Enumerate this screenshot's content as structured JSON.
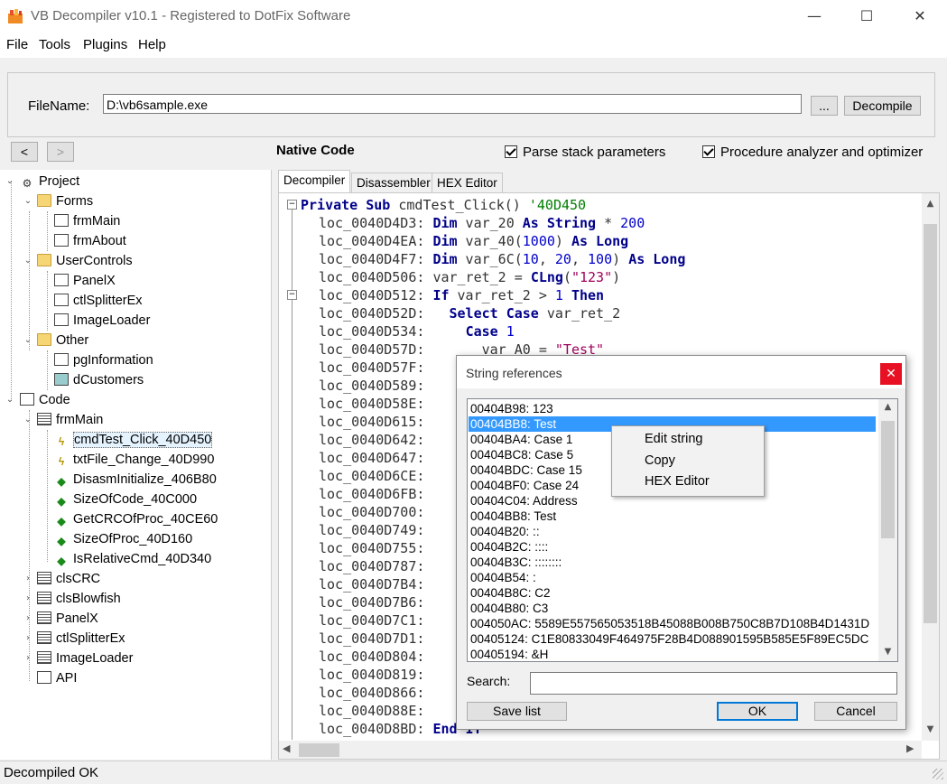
{
  "window": {
    "title": "VB Decompiler v10.1 - Registered to DotFix Software",
    "minimize": "—",
    "maximize": "☐",
    "close": "✕"
  },
  "menu": {
    "file": "File",
    "tools": "Tools",
    "plugins": "Plugins",
    "help": "Help"
  },
  "file_panel": {
    "label": "FileName:",
    "value": "D:\\vb6sample.exe",
    "browse": "...",
    "decompile": "Decompile"
  },
  "nav": {
    "back": "<",
    "forward": ">",
    "section_title": "Native Code",
    "parse_stack": "Parse stack parameters",
    "proc_analyzer": "Procedure analyzer and optimizer"
  },
  "tree": {
    "project": "Project",
    "forms": "Forms",
    "frmMain": "frmMain",
    "frmAbout": "frmAbout",
    "usercontrols": "UserControls",
    "PanelX": "PanelX",
    "ctlSplitterEx": "ctlSplitterEx",
    "ImageLoader": "ImageLoader",
    "other": "Other",
    "pgInformation": "pgInformation",
    "dCustomers": "dCustomers",
    "code": "Code",
    "code_frmMain": "frmMain",
    "procs": [
      "cmdTest_Click_40D450",
      "txtFile_Change_40D990",
      "DisasmInitialize_406B80",
      "SizeOfCode_40C000",
      "GetCRCOfProc_40CE60",
      "SizeOfProc_40D160",
      "IsRelativeCmd_40D340"
    ],
    "modules": [
      "clsCRC",
      "clsBlowfish",
      "PanelX",
      "ctlSplitterEx",
      "ImageLoader"
    ],
    "api": "API"
  },
  "tabs": {
    "decompiler": "Decompiler",
    "disassembler": "Disassembler",
    "hex": "HEX Editor"
  },
  "code": {
    "header": {
      "kw": "Private Sub",
      "name": " cmdTest_Click()",
      "comment": " '40D450"
    },
    "l1": {
      "loc": "loc_0040D4D3:",
      "kw1": "Dim",
      "t1": " var_20 ",
      "kw2": "As String",
      "t2": " * ",
      "n1": "200"
    },
    "l2": {
      "loc": "loc_0040D4EA:",
      "kw1": "Dim",
      "t1": " var_40(",
      "n1": "1000",
      "t2": ") ",
      "kw2": "As Long"
    },
    "l3": {
      "loc": "loc_0040D4F7:",
      "kw1": "Dim",
      "t1": " var_6C(",
      "n1": "10",
      "t2": ", ",
      "n2": "20",
      "t3": ", ",
      "n3": "100",
      "t4": ") ",
      "kw2": "As Long"
    },
    "l4": {
      "loc": "loc_0040D506:",
      "t1": "var_ret_2 = ",
      "kw1": "CLng",
      "t2": "(",
      "s1": "\"123\"",
      "t3": ")"
    },
    "l5": {
      "loc": "loc_0040D512:",
      "kw1": "If",
      "t1": " var_ret_2 > ",
      "n1": "1",
      "t2": " ",
      "kw2": "Then"
    },
    "l6": {
      "loc": "loc_0040D52D:",
      "t0": "  ",
      "kw1": "Select Case",
      "t1": " var_ret_2"
    },
    "l7": {
      "loc": "loc_0040D534:",
      "t0": "    ",
      "kw1": "Case",
      "t1": " ",
      "n1": "1"
    },
    "l8": {
      "loc": "loc_0040D57D:",
      "t0": "      ",
      "t1": "var_A0 = ",
      "s1": "\"Test\""
    },
    "locs": [
      "loc_0040D57F:",
      "loc_0040D589:",
      "loc_0040D58E:",
      "loc_0040D615:",
      "loc_0040D642:",
      "loc_0040D647:",
      "loc_0040D6CE:",
      "loc_0040D6FB:",
      "loc_0040D700:",
      "loc_0040D749:",
      "loc_0040D755:",
      "loc_0040D787:",
      "loc_0040D7B4:",
      "loc_0040D7B6:",
      "loc_0040D7C1:",
      "loc_0040D7D1:",
      "loc_0040D804:",
      "loc_0040D819:",
      "loc_0040D866:",
      "loc_0040D88E:"
    ],
    "last": {
      "loc": "loc_0040D8BD:",
      "kw1": "End If"
    }
  },
  "dialog": {
    "title": "String references",
    "close": "✕",
    "items": [
      "00404B98: 123",
      "00404BB8: Test",
      "00404BA4: Case 1",
      "00404BC8: Case 5",
      "00404BDC: Case 15",
      "00404BF0: Case 24",
      "00404C04: Address",
      "00404BB8: Test",
      "00404B20: ::",
      "00404B2C: ::::",
      "00404B3C: ::::::::",
      "00404B54: :",
      "00404B8C: C2",
      "00404B80: C3",
      "004050AC: 5589E557565053518B45088B008B750C8B7D108B4D1431D",
      "00405124: C1E80833049F464975F28B4D088901595B585E5F89EC5DC",
      "00405194: &H"
    ],
    "selected_index": 1,
    "search_label": "Search:",
    "search_value": "",
    "save": "Save list",
    "ok": "OK",
    "cancel": "Cancel"
  },
  "context_menu": {
    "items": [
      "Edit string",
      "Copy",
      "HEX Editor"
    ]
  },
  "status": {
    "text": "Decompiled OK"
  }
}
